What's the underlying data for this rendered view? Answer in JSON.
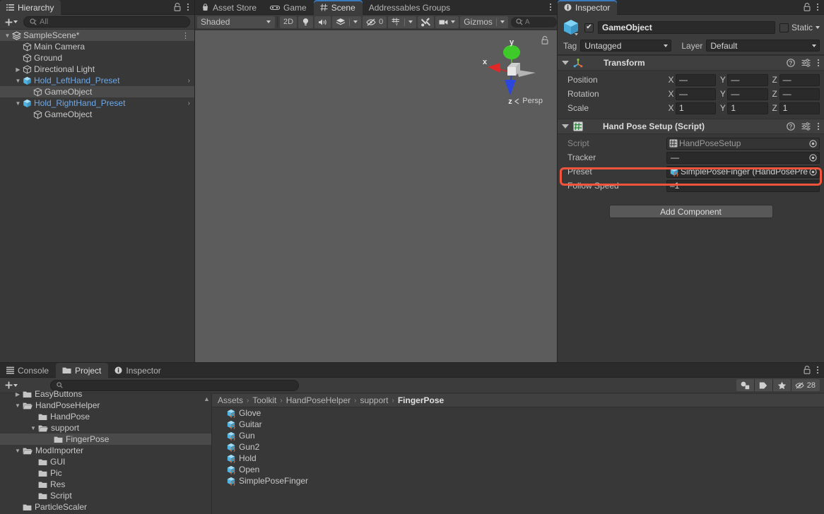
{
  "hierarchy": {
    "tab_label": "Hierarchy",
    "add_label": "+",
    "search_placeholder": "All",
    "items": [
      {
        "label": "SampleScene*",
        "icon": "scene-icon",
        "depth": 0,
        "arrow": "down",
        "kebab": true,
        "style": "scene"
      },
      {
        "label": "Main Camera",
        "icon": "gameobject-icon",
        "depth": 1,
        "arrow": "none",
        "style": "normal"
      },
      {
        "label": "Ground",
        "icon": "gameobject-icon",
        "depth": 1,
        "arrow": "none",
        "style": "normal"
      },
      {
        "label": "Directional Light",
        "icon": "gameobject-icon",
        "depth": 1,
        "arrow": "right",
        "style": "normal"
      },
      {
        "label": "Hold_LeftHand_Preset",
        "icon": "prefab-icon",
        "depth": 1,
        "arrow": "down",
        "chevron": true,
        "style": "prefab"
      },
      {
        "label": "GameObject",
        "icon": "gameobject-icon",
        "depth": 2,
        "arrow": "none",
        "style": "selected"
      },
      {
        "label": "Hold_RightHand_Preset",
        "icon": "prefab-icon",
        "depth": 1,
        "arrow": "down",
        "chevron": true,
        "style": "prefab"
      },
      {
        "label": "GameObject",
        "icon": "gameobject-icon",
        "depth": 2,
        "arrow": "none",
        "style": "normal"
      }
    ]
  },
  "scene": {
    "tabs": [
      {
        "label": "Asset Store",
        "icon": "store-icon",
        "active": false
      },
      {
        "label": "Game",
        "icon": "gamepad-icon",
        "active": false
      },
      {
        "label": "Scene",
        "icon": "grid-icon",
        "active": true
      },
      {
        "label": "Addressables Groups",
        "icon": "none",
        "active": false
      }
    ],
    "toolbar": {
      "shading_mode": "Shaded",
      "mode_2d": "2D",
      "lighting_icon": "bulb-icon",
      "audio_icon": "speaker-icon",
      "fx_icon": "fx-icon",
      "hidden_count": "0",
      "grid_icon": "grid-visibility-icon",
      "tools_icon": "tools-icon",
      "camera_icon": "camera-icon",
      "gizmos_label": "Gizmos",
      "search_placeholder": "A"
    },
    "gizmo": {
      "axis_x": "x",
      "axis_y": "y",
      "axis_z": "z",
      "projection": "Persp"
    }
  },
  "inspector": {
    "tab_label": "Inspector",
    "object_name": "GameObject",
    "enabled": true,
    "static_label": "Static",
    "tag_label": "Tag",
    "tag_value": "Untagged",
    "layer_label": "Layer",
    "layer_value": "Default",
    "components": [
      {
        "title": "Transform",
        "icon": "transform-icon",
        "rows": [
          {
            "label": "Position",
            "type": "vec3",
            "x": "—",
            "y": "—",
            "z": "—"
          },
          {
            "label": "Rotation",
            "type": "vec3",
            "x": "—",
            "y": "—",
            "z": "—"
          },
          {
            "label": "Scale",
            "type": "vec3",
            "x": "1",
            "y": "1",
            "z": "1"
          }
        ]
      },
      {
        "title": "Hand Pose Setup (Script)",
        "icon": "script-icon",
        "rows": [
          {
            "label": "Script",
            "type": "object",
            "value": "HandPoseSetup",
            "dim": true,
            "icon": "script-asset-icon"
          },
          {
            "label": "Tracker",
            "type": "object",
            "value": "—",
            "dim": false,
            "icon": "none"
          },
          {
            "label": "Preset",
            "type": "object",
            "value": "SimplePoseFinger (HandPosePre",
            "dim": false,
            "icon": "prefab-asset-icon",
            "highlighted": true
          },
          {
            "label": "Follow Speed",
            "type": "number",
            "value": "–1"
          }
        ]
      }
    ],
    "add_component_label": "Add Component"
  },
  "project": {
    "tabs": [
      {
        "label": "Console",
        "icon": "console-icon",
        "active": false
      },
      {
        "label": "Project",
        "icon": "folder-icon",
        "active": true
      },
      {
        "label": "Inspector",
        "icon": "info-icon",
        "active": false
      }
    ],
    "add_label": "+",
    "search_placeholder": "",
    "hidden_count": "28",
    "folders": [
      {
        "label": "EasyButtons",
        "depth": 1,
        "arrow": "right",
        "open": false,
        "selected": false,
        "clipped": true
      },
      {
        "label": "HandPoseHelper",
        "depth": 1,
        "arrow": "down",
        "open": true,
        "selected": false
      },
      {
        "label": "HandPose",
        "depth": 2,
        "arrow": "none",
        "open": false,
        "selected": false
      },
      {
        "label": "support",
        "depth": 2,
        "arrow": "down",
        "open": true,
        "selected": false
      },
      {
        "label": "FingerPose",
        "depth": 3,
        "arrow": "none",
        "open": false,
        "selected": true
      },
      {
        "label": "ModImporter",
        "depth": 1,
        "arrow": "down",
        "open": true,
        "selected": false
      },
      {
        "label": "GUI",
        "depth": 2,
        "arrow": "none",
        "open": false,
        "selected": false
      },
      {
        "label": "Pic",
        "depth": 2,
        "arrow": "none",
        "open": false,
        "selected": false
      },
      {
        "label": "Res",
        "depth": 2,
        "arrow": "none",
        "open": false,
        "selected": false
      },
      {
        "label": "Script",
        "depth": 2,
        "arrow": "none",
        "open": false,
        "selected": false
      },
      {
        "label": "ParticleScaler",
        "depth": 1,
        "arrow": "none",
        "open": false,
        "selected": false
      }
    ],
    "breadcrumb": [
      "Assets",
      "Toolkit",
      "HandPoseHelper",
      "support",
      "FingerPose"
    ],
    "assets": [
      {
        "label": "Glove",
        "icon": "prefab-asset-icon"
      },
      {
        "label": "Guitar",
        "icon": "prefab-asset-icon"
      },
      {
        "label": "Gun",
        "icon": "prefab-asset-icon"
      },
      {
        "label": "Gun2",
        "icon": "prefab-asset-icon"
      },
      {
        "label": "Hold",
        "icon": "prefab-asset-icon"
      },
      {
        "label": "Open",
        "icon": "prefab-asset-icon"
      },
      {
        "label": "SimplePoseFinger",
        "icon": "prefab-asset-icon"
      }
    ]
  },
  "colors": {
    "accent_blue": "#3a79bb",
    "prefab_blue": "#6ea8e6",
    "highlight_red": "#f4533c",
    "panel_bg": "#383838",
    "viewport_bg": "#5c5c5c"
  }
}
